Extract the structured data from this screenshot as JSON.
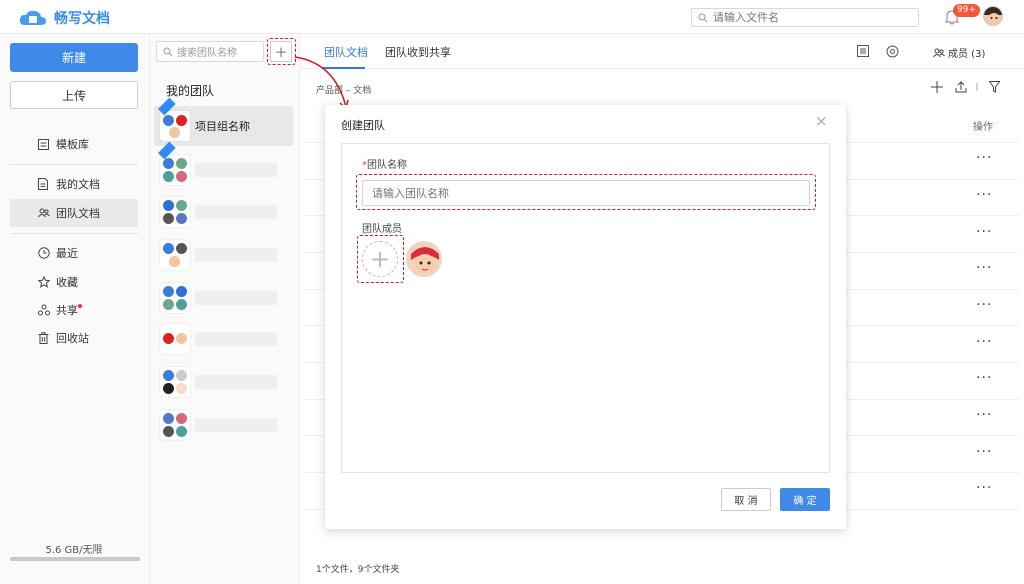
{
  "app": {
    "name": "畅写文档"
  },
  "topbar": {
    "search_placeholder": "请输入文件名",
    "notification_badge": "99+"
  },
  "leftnav": {
    "new_label": "新建",
    "upload_label": "上传",
    "items": [
      {
        "label": "模板库",
        "icon": "template-icon"
      },
      {
        "label": "我的文档",
        "icon": "document-icon"
      },
      {
        "label": "团队文档",
        "icon": "team-icon",
        "active": true
      },
      {
        "label": "最近",
        "icon": "clock-icon"
      },
      {
        "label": "收藏",
        "icon": "star-icon"
      },
      {
        "label": "共享",
        "icon": "share-icon"
      },
      {
        "label": "回收站",
        "icon": "trash-icon"
      }
    ],
    "storage": "5.6 GB/无限"
  },
  "teampanel": {
    "search_placeholder": "搜索团队名称",
    "add_label": "+",
    "heading": "我的团队",
    "teams": [
      {
        "name": "项目组名称",
        "active": true
      }
    ]
  },
  "main": {
    "tabs": [
      {
        "label": "团队文档",
        "active": true
      },
      {
        "label": "团队收到共享",
        "active": false
      }
    ],
    "members_label": "成员 (3)",
    "breadcrumb": "产品部 – 文档",
    "column_operation": "操作",
    "row_menu": "···",
    "file_count": "1个文件，9个文件夹"
  },
  "dialog": {
    "title": "创建团队",
    "close": "×",
    "name_required_mark": "*",
    "name_label": "团队名称",
    "name_placeholder": "请输入团队名称",
    "members_label": "团队成员",
    "add_member": "+",
    "cancel_label": "取 消",
    "ok_label": "确 定"
  },
  "colors": {
    "accent": "#3f8ae8",
    "annotation": "#c81d27"
  }
}
